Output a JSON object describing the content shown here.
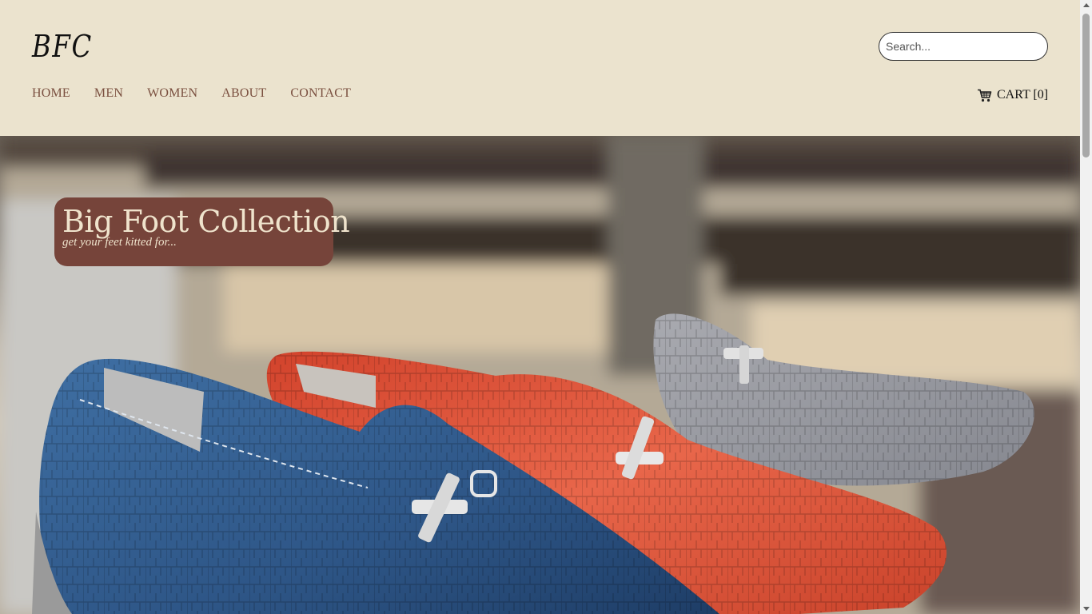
{
  "brand": {
    "logo": "BFC"
  },
  "search": {
    "placeholder": "Search..."
  },
  "nav": {
    "items": [
      {
        "label": "HOME"
      },
      {
        "label": "MEN"
      },
      {
        "label": "WOMEN"
      },
      {
        "label": "ABOUT"
      },
      {
        "label": "CONTACT"
      }
    ]
  },
  "cart": {
    "label": "CART [0]",
    "icon": "shopping-cart-icon"
  },
  "hero": {
    "title": "Big Foot Collection",
    "tagline": "get your feet kitted for...",
    "image": "loafer-shoes-photo"
  },
  "colors": {
    "header_bg": "#ebe3ce",
    "nav_text": "#7a4f3f",
    "badge_bg": "#76443a",
    "badge_text": "#efe3cc"
  }
}
